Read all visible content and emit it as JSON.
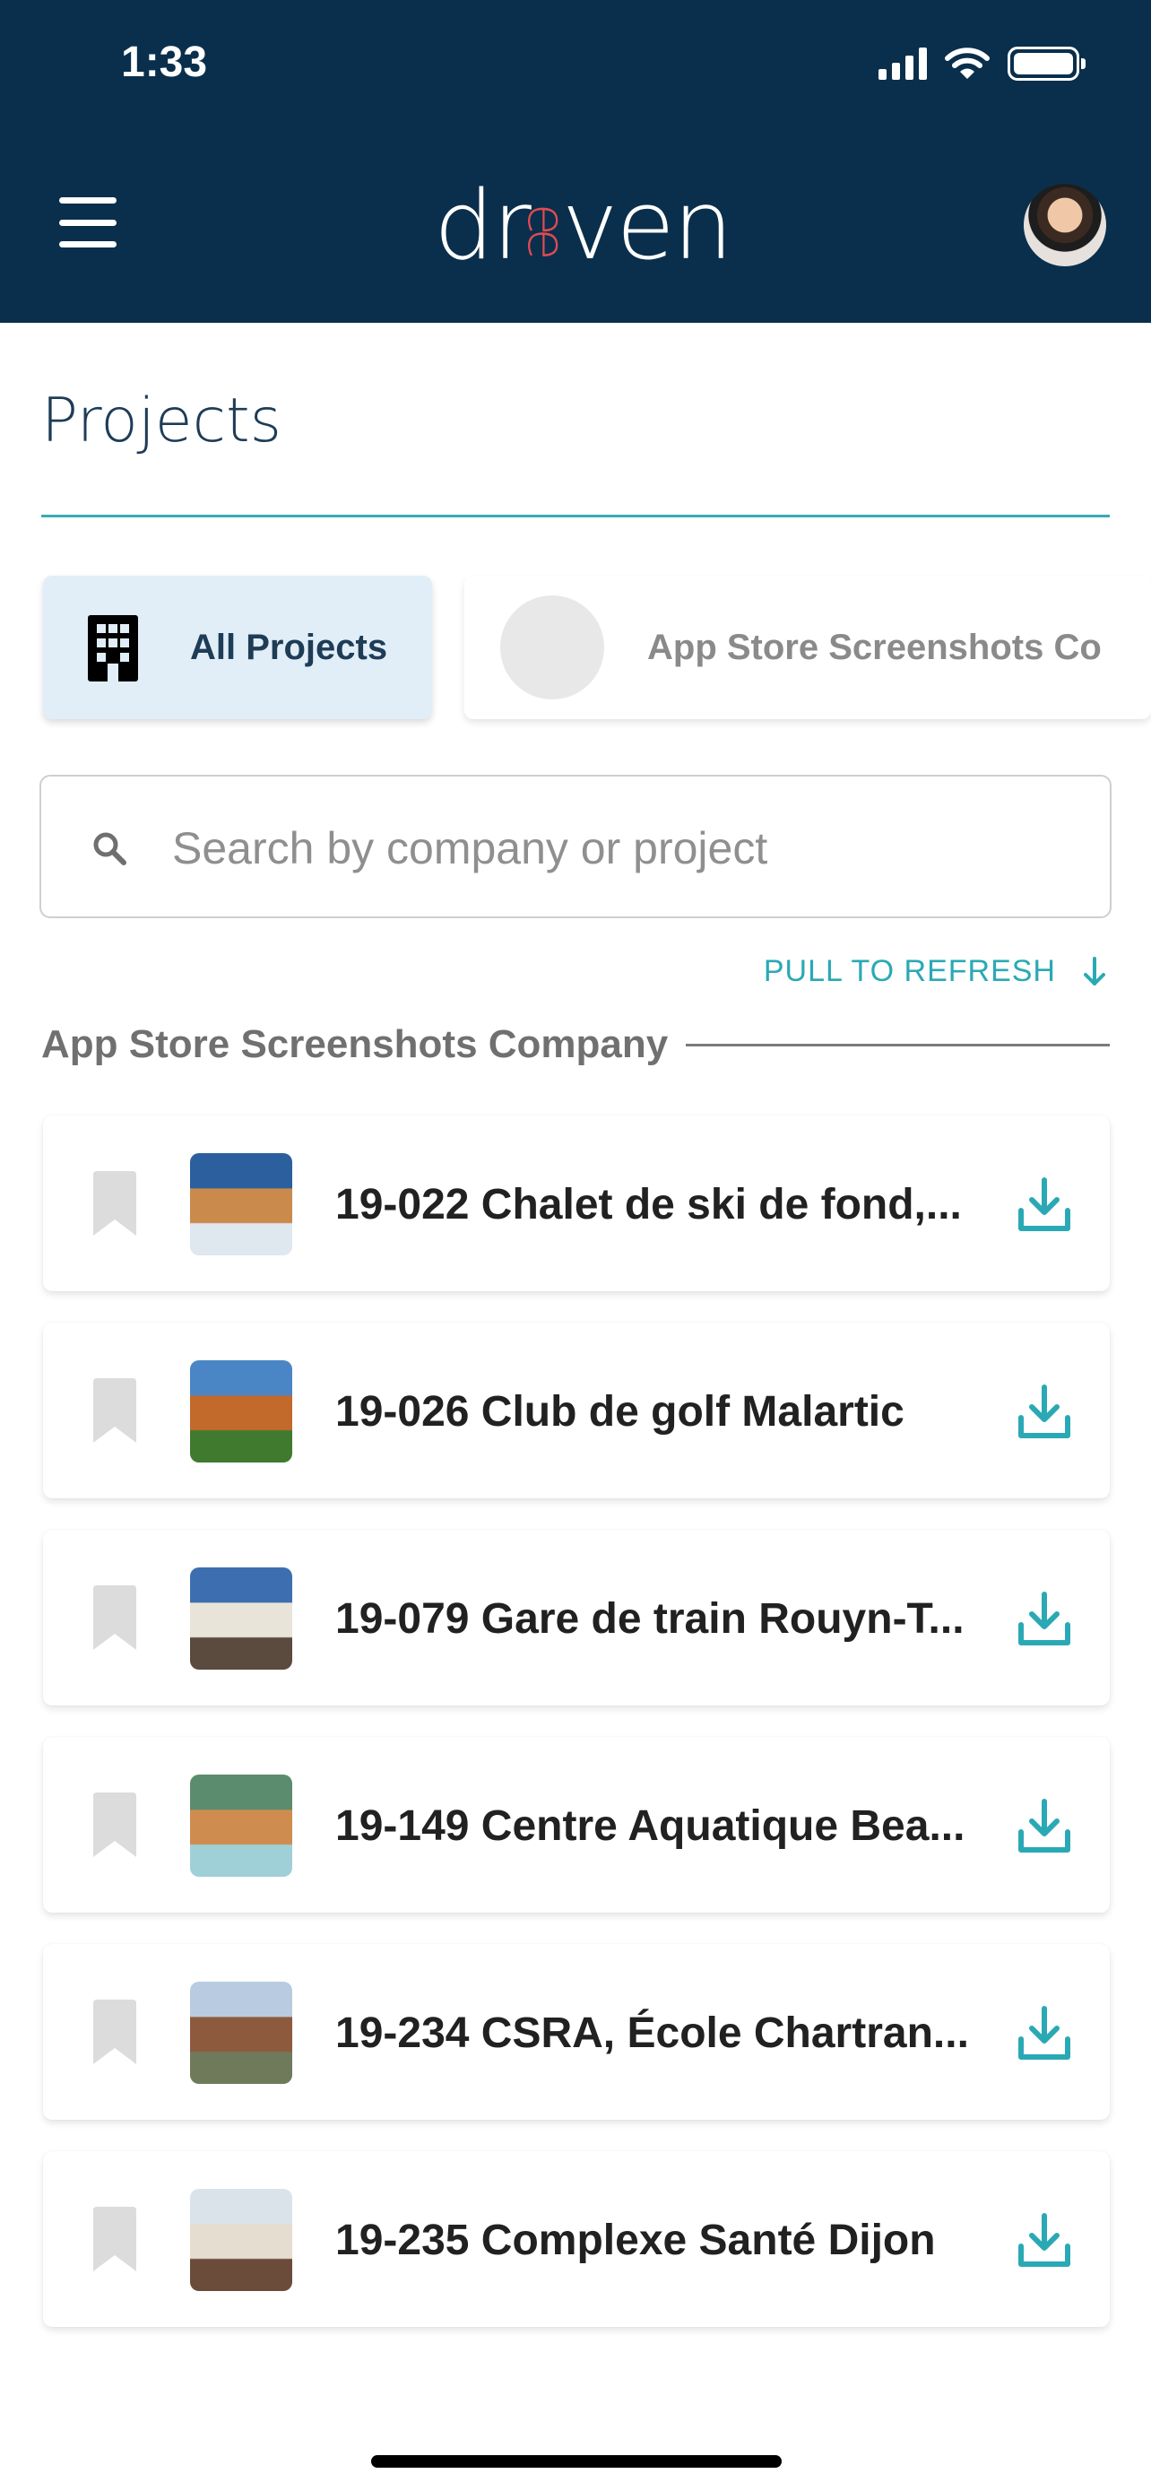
{
  "status_bar": {
    "time": "1:33"
  },
  "header": {
    "logo_left": "dr",
    "logo_mid": "ee",
    "logo_right": "ven",
    "background": "#0a2f4c"
  },
  "page": {
    "title": "Projects"
  },
  "filters": [
    {
      "label": "All Projects",
      "icon": "building-icon",
      "selected": true
    },
    {
      "label": "App Store Screenshots Co",
      "icon": "company-logo-placeholder",
      "selected": false
    }
  ],
  "search": {
    "placeholder": "Search by company or project",
    "value": ""
  },
  "pull_to_refresh": "PULL TO REFRESH",
  "section": {
    "title": "App Store Screenshots Company"
  },
  "projects": [
    {
      "title": "19-022 Chalet de ski de fond,...",
      "thumb": [
        "#2c5f9e",
        "#c98a4b",
        "#dfe7ef"
      ]
    },
    {
      "title": "19-026 Club de golf Malartic",
      "thumb": [
        "#4a86c6",
        "#c26a2c",
        "#3f7a2e"
      ]
    },
    {
      "title": "19-079 Gare de train Rouyn-T...",
      "thumb": [
        "#3d6fb0",
        "#e9e4da",
        "#5b4a3e"
      ]
    },
    {
      "title": "19-149 Centre Aquatique Bea...",
      "thumb": [
        "#5c8c6e",
        "#cf8c4f",
        "#9fd0d8"
      ]
    },
    {
      "title": "19-234 CSRA, École Chartran...",
      "thumb": [
        "#b9cbe0",
        "#8e5a3e",
        "#6f7a5a"
      ]
    },
    {
      "title": "19-235 Complexe Santé Dijon",
      "thumb": [
        "#dbe3ea",
        "#e5ddcf",
        "#6b4c3a"
      ]
    }
  ],
  "colors": {
    "accent": "#2aa9b5",
    "title": "#1e3c56",
    "logo_accent": "#e14b52"
  }
}
